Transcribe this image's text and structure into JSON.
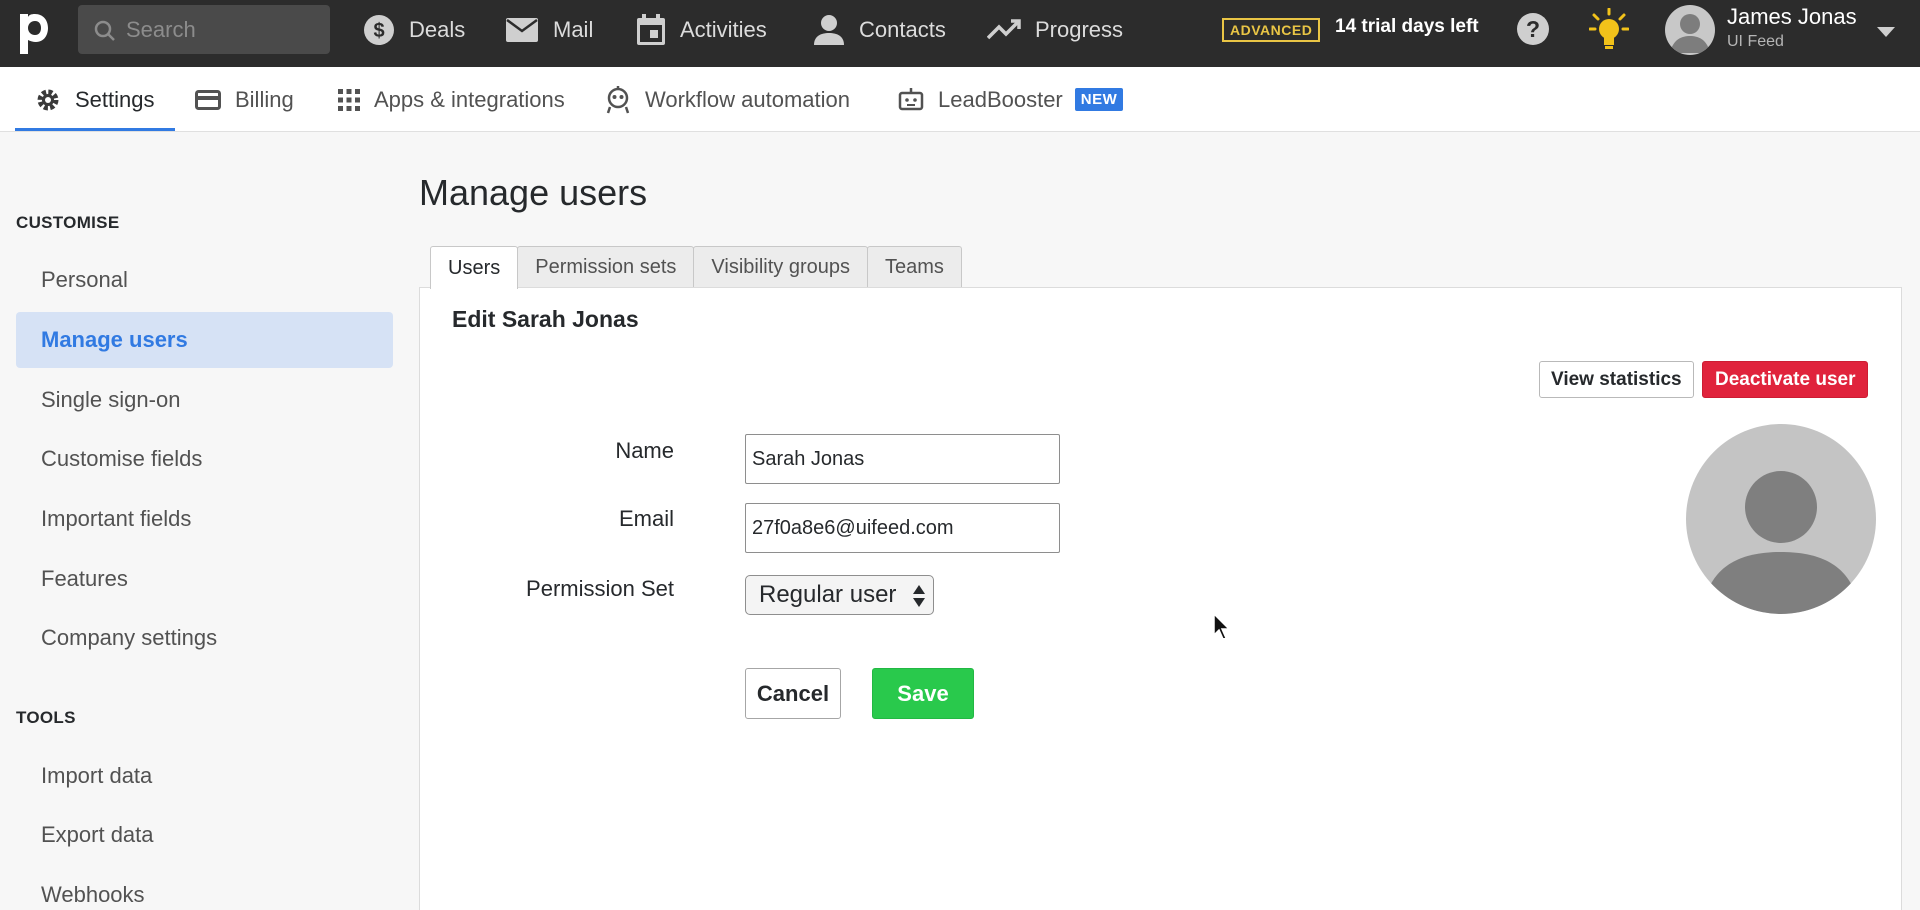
{
  "topbar": {
    "logo_letter": "p",
    "search_placeholder": "Search",
    "nav": [
      {
        "label": "Deals",
        "icon": "dollar-icon"
      },
      {
        "label": "Mail",
        "icon": "mail-icon"
      },
      {
        "label": "Activities",
        "icon": "calendar-icon"
      },
      {
        "label": "Contacts",
        "icon": "person-icon"
      },
      {
        "label": "Progress",
        "icon": "trend-icon"
      }
    ],
    "plan_badge": "ADVANCED",
    "trial_text": "14 trial days left",
    "user_name": "James Jonas",
    "user_company": "UI Feed"
  },
  "subnav": {
    "tabs": [
      {
        "label": "Settings",
        "icon": "gear-icon",
        "active": true
      },
      {
        "label": "Billing",
        "icon": "card-icon"
      },
      {
        "label": "Apps & integrations",
        "icon": "grid-icon"
      },
      {
        "label": "Workflow automation",
        "icon": "robot-icon"
      },
      {
        "label": "LeadBooster",
        "icon": "chatbot-icon",
        "badge": "NEW"
      }
    ]
  },
  "sidebar": {
    "customise_heading": "CUSTOMISE",
    "customise_items": [
      "Personal",
      "Manage users",
      "Single sign-on",
      "Customise fields",
      "Important fields",
      "Features",
      "Company settings"
    ],
    "active_item": "Manage users",
    "tools_heading": "TOOLS",
    "tools_items": [
      "Import data",
      "Export data",
      "Webhooks"
    ]
  },
  "main": {
    "title": "Manage users",
    "tabs": [
      "Users",
      "Permission sets",
      "Visibility groups",
      "Teams"
    ],
    "active_tab": "Users",
    "panel_title": "Edit Sarah Jonas",
    "view_statistics_label": "View statistics",
    "deactivate_label": "Deactivate user",
    "form": {
      "name_label": "Name",
      "name_value": "Sarah Jonas",
      "email_label": "Email",
      "email_value": "27f0a8e6@uifeed.com",
      "permission_label": "Permission Set",
      "permission_value": "Regular user"
    },
    "cancel_label": "Cancel",
    "save_label": "Save"
  },
  "colors": {
    "topbar_bg": "#2c2c2c",
    "accent_blue": "#317ae2",
    "save_green": "#29c94c",
    "danger_red": "#e0233c",
    "badge_yellow": "#e9c545"
  }
}
